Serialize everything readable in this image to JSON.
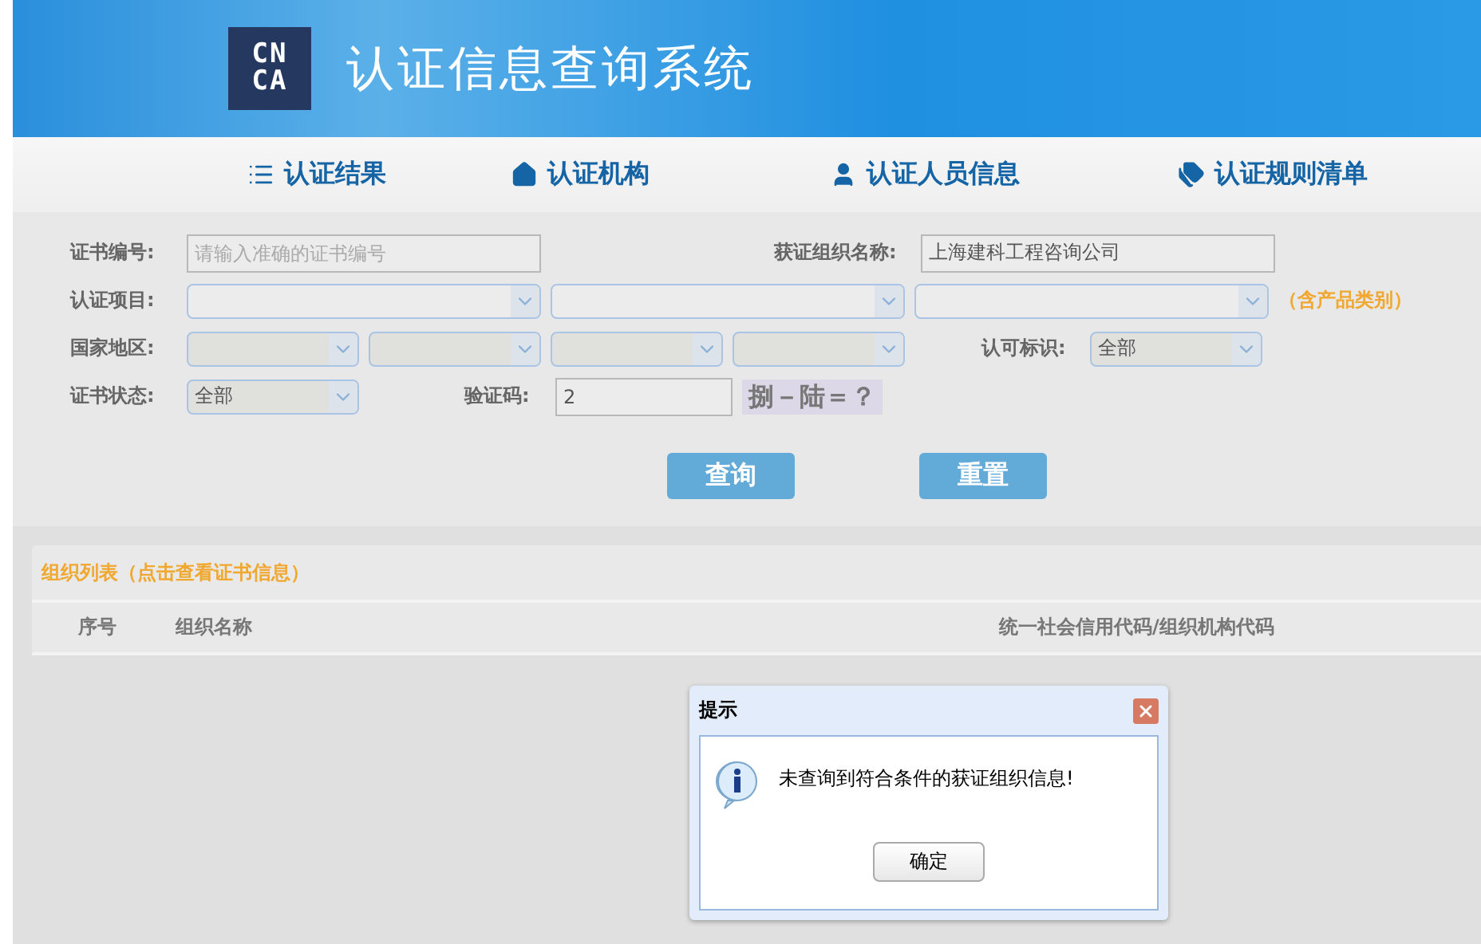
{
  "header": {
    "logo": {
      "top": "CN",
      "bottom": "CA"
    },
    "title": "认证信息查询系统"
  },
  "nav": [
    {
      "label": "认证结果"
    },
    {
      "label": "认证机构"
    },
    {
      "label": "认证人员信息"
    },
    {
      "label": "认证规则清单"
    }
  ],
  "form": {
    "certificate_number": {
      "label": "证书编号:",
      "placeholder": "请输入准确的证书编号"
    },
    "organization_name": {
      "label": "获证组织名称:",
      "value": "上海建科工程咨询公司"
    },
    "certification_project": {
      "label": "认证项目:",
      "selects": [
        {
          "kind": "empty"
        },
        {
          "kind": "empty"
        },
        {
          "kind": "empty"
        }
      ],
      "note": "（含产品类别）"
    },
    "country_region": {
      "label": "国家地区:",
      "selects": [
        {
          "kind": "empty"
        },
        {
          "kind": "empty"
        },
        {
          "kind": "empty"
        },
        {
          "kind": "empty"
        }
      ]
    },
    "accreditation_mark": {
      "label": "认可标识:",
      "value": "全部"
    },
    "certificate_status": {
      "label": "证书状态:",
      "value": "全部"
    },
    "captcha": {
      "label": "验证码:",
      "value": "2",
      "question": "捌－陆＝？"
    },
    "buttons": [
      "查询",
      "重置"
    ]
  },
  "table": {
    "title": "组织列表（点击查看证书信息）",
    "columns": [
      "序号",
      "组织名称",
      "统一社会信用代码/组织机构代码"
    ]
  },
  "dialog": {
    "title": "提示",
    "message": "未查询到符合条件的获证组织信息!",
    "button": "确定"
  }
}
